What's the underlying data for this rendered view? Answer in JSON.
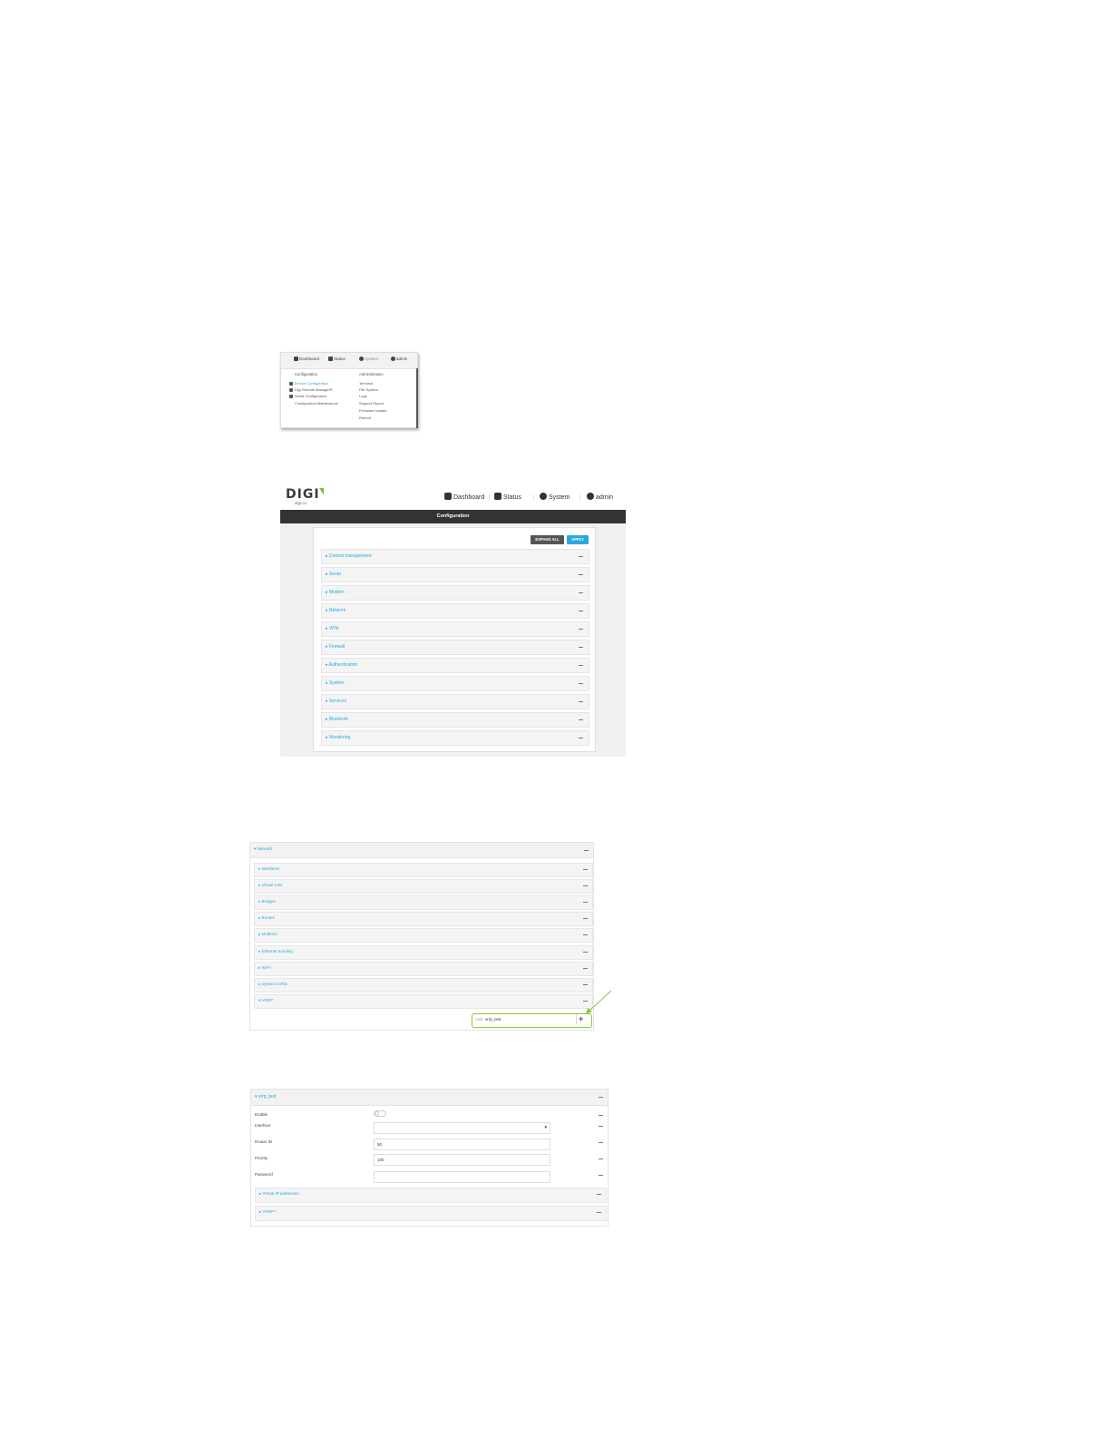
{
  "nav": {
    "dashboard": "Dashboard",
    "status": "Status",
    "system": "System",
    "admin": "admin"
  },
  "system_menu": {
    "config_header": "Configuration",
    "admin_header": "Administration",
    "config_items": [
      "Device Configuration",
      "Digi Remote Manager®",
      "Serial Configuration",
      "Configuration Maintenance"
    ],
    "admin_items": [
      "Terminal",
      "File System",
      "Logs",
      "Support Report",
      "Firmware Update",
      "Reboot"
    ]
  },
  "config_page": {
    "logo": "DIGI",
    "logo_sub": "digi.co",
    "title": "Configuration",
    "expand_all": "EXPAND ALL",
    "apply": "APPLY",
    "sections": [
      "Central management",
      "Serial",
      "Modem",
      "Network",
      "VPN",
      "Firewall",
      "Authentication",
      "System",
      "Services",
      "Bluetooth",
      "Monitoring"
    ]
  },
  "network_panel": {
    "title": "Network",
    "items": [
      "Interfaces",
      "Virtual LAN",
      "Bridges",
      "Routes",
      "Modems",
      "Ethernet bonding",
      "Wi-Fi",
      "Dynamic DNS",
      "VRRP"
    ],
    "add_label": "Add",
    "add_value": "vrrp_test",
    "add_button": "+"
  },
  "vrrp_panel": {
    "title": "vrrp_test",
    "fields": [
      {
        "label": "Enable",
        "value": ""
      },
      {
        "label": "Interface",
        "value": ""
      },
      {
        "label": "Router ID",
        "value": "50"
      },
      {
        "label": "Priority",
        "value": "100"
      },
      {
        "label": "Password",
        "value": ""
      }
    ],
    "subsections": [
      "Virtual IP addresses",
      "VRRP+"
    ]
  },
  "colors": {
    "accent": "#2aa8e0",
    "dark_bar": "#333333",
    "green": "#8cc63f",
    "expand_btn": "#555555",
    "apply_btn": "#2aa8e0"
  }
}
